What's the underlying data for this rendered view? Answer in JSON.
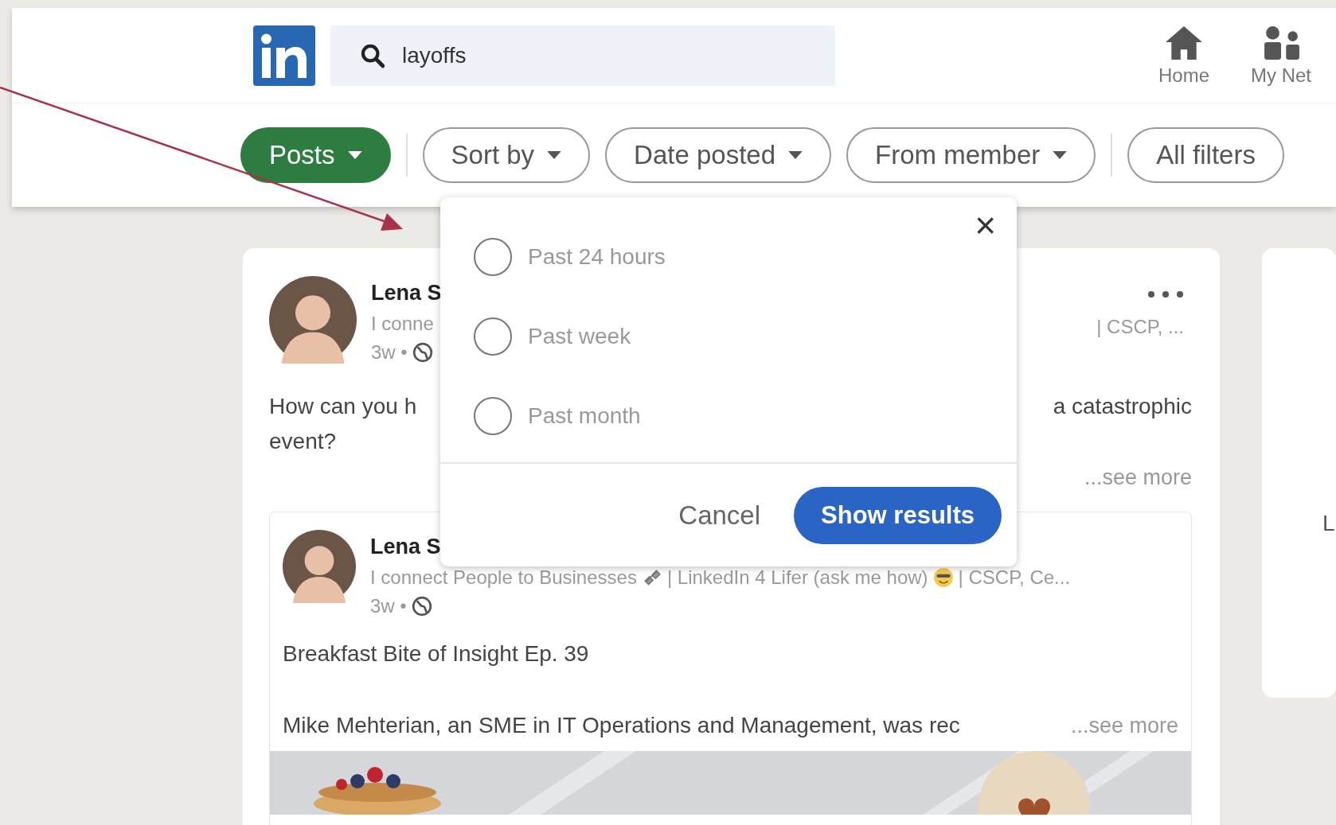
{
  "header": {
    "search": {
      "value": "layoffs"
    },
    "nav": [
      {
        "kind": "home",
        "label": "Home"
      },
      {
        "kind": "network",
        "label": "My Net"
      }
    ]
  },
  "filters": [
    {
      "label": "Posts",
      "selected": true,
      "dropdown": true
    },
    {
      "label": "Sort by",
      "selected": false,
      "dropdown": true
    },
    {
      "label": "Date posted",
      "selected": false,
      "dropdown": true
    },
    {
      "label": "From member",
      "selected": false,
      "dropdown": true
    },
    {
      "label": "All filters",
      "selected": false,
      "dropdown": false
    }
  ],
  "post": {
    "name": "Lena S",
    "subtitle_left": "I conne",
    "subtitle_right": "| CSCP, ...",
    "time": "3w •",
    "text_left": "How can you h",
    "text_right": "a catastrophic",
    "text_line2": "event?",
    "see_more": "...see more",
    "shared": {
      "name": "Lena S",
      "subtitle_1": "I connect People to Businesses",
      "subtitle_2": "| LinkedIn 4 Lifer (ask me how)",
      "subtitle_3": "| CSCP, Ce...",
      "time": "3w •",
      "title": "Breakfast Bite of Insight Ep. 39",
      "body": "Mike Mehterian, an SME in IT Operations and Management, was rec",
      "see_more": "...see more"
    }
  },
  "side_card": {
    "text": "L"
  },
  "date_dropdown": {
    "close": "×",
    "options": [
      {
        "label": "Past 24 hours",
        "selected": false
      },
      {
        "label": "Past week",
        "selected": false
      },
      {
        "label": "Past month",
        "selected": false
      }
    ],
    "cancel": "Cancel",
    "submit": "Show results"
  }
}
